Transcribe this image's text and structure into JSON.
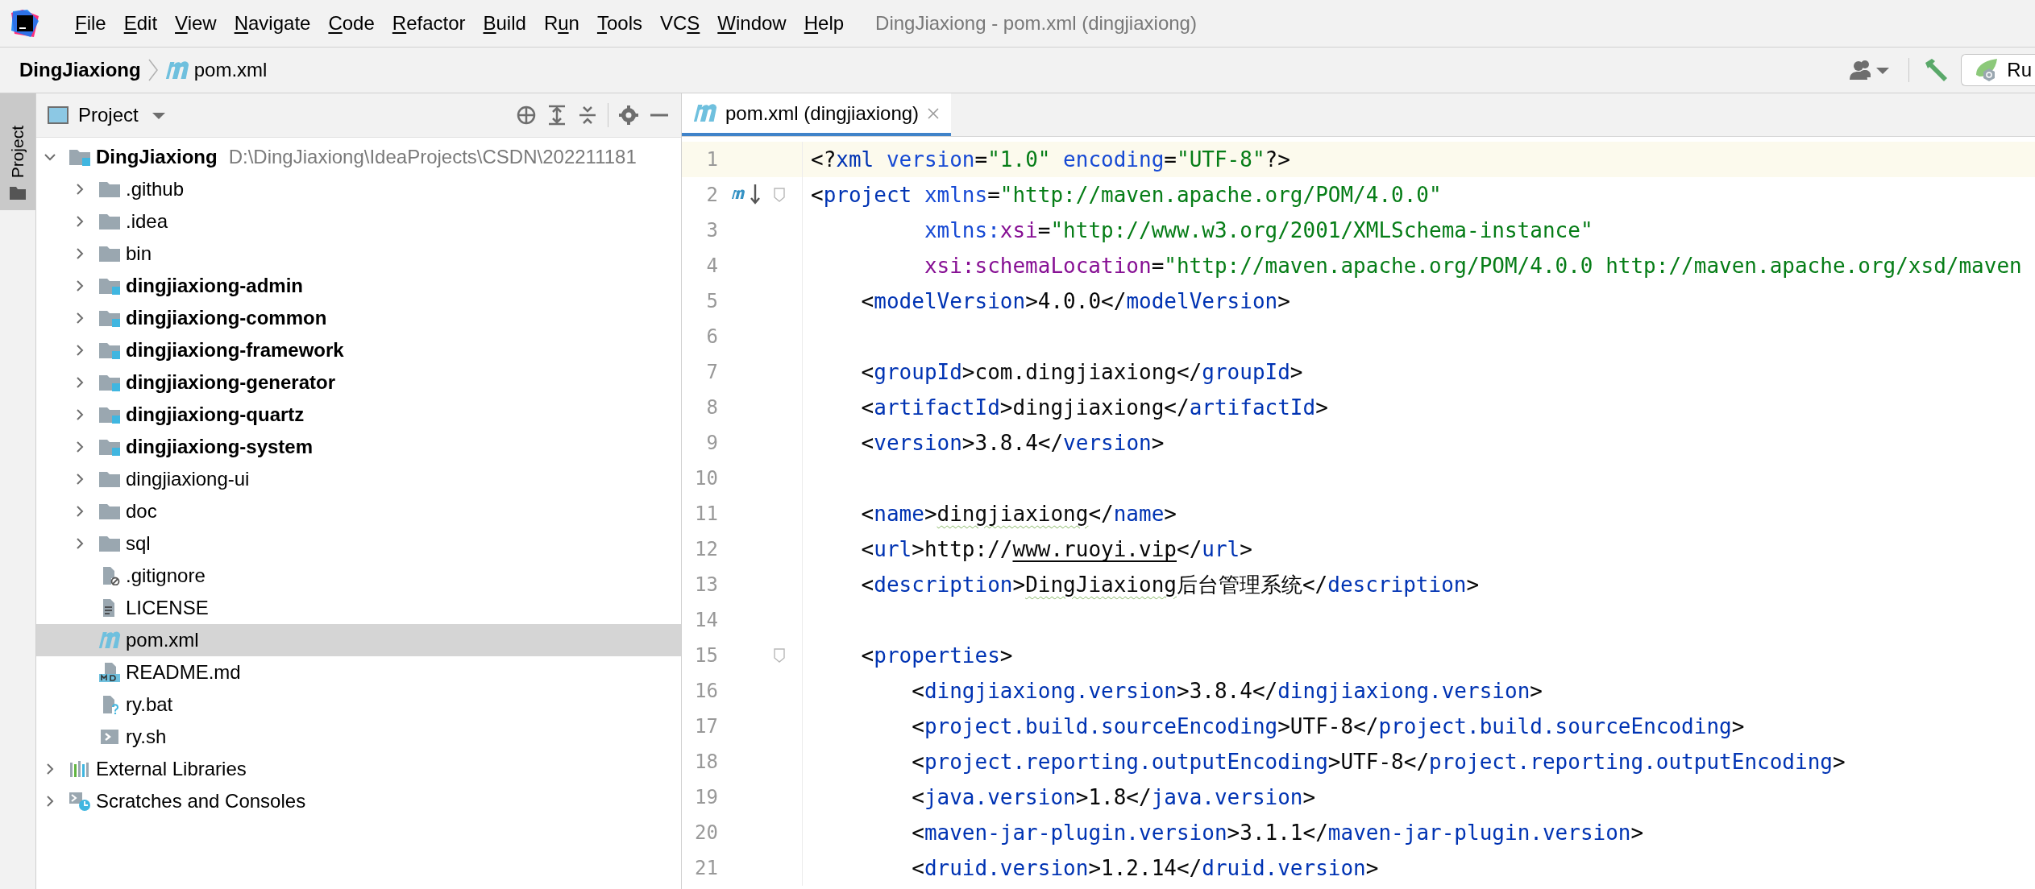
{
  "window": {
    "title": "DingJiaxiong - pom.xml (dingjiaxiong)"
  },
  "menu": [
    {
      "key": "F",
      "post": "ile"
    },
    {
      "key": "E",
      "post": "dit"
    },
    {
      "key": "V",
      "post": "iew"
    },
    {
      "key": "N",
      "post": "avigate"
    },
    {
      "key": "C",
      "post": "ode"
    },
    {
      "key": "R",
      "post": "efactor"
    },
    {
      "key": "B",
      "post": "uild"
    },
    {
      "pre": "R",
      "key": "u",
      "post": "n"
    },
    {
      "key": "T",
      "post": "ools"
    },
    {
      "pre": "VC",
      "key": "S"
    },
    {
      "key": "W",
      "post": "indow"
    },
    {
      "key": "H",
      "post": "elp"
    }
  ],
  "breadcrumbs": [
    {
      "label": "DingJiaxiong",
      "kind": "project"
    },
    {
      "label": "pom.xml",
      "kind": "maven"
    }
  ],
  "toolbar": {
    "run_config": "Ru"
  },
  "side_stripe": {
    "label": "Project"
  },
  "project_panel": {
    "title": "Project",
    "tree": [
      {
        "label": "DingJiaxiong",
        "path": "D:\\DingJiaxiong\\IdeaProjects\\CSDN\\202211181",
        "kind": "module",
        "expanded": true,
        "selected": false,
        "children": [
          {
            "label": ".github",
            "kind": "folder",
            "expanded": false,
            "selected": false
          },
          {
            "label": ".idea",
            "kind": "folder",
            "expanded": false,
            "selected": false
          },
          {
            "label": "bin",
            "kind": "folder",
            "expanded": false,
            "selected": false
          },
          {
            "label": "dingjiaxiong-admin",
            "kind": "module",
            "expanded": false,
            "selected": false
          },
          {
            "label": "dingjiaxiong-common",
            "kind": "module",
            "expanded": false,
            "selected": false
          },
          {
            "label": "dingjiaxiong-framework",
            "kind": "module",
            "expanded": false,
            "selected": false
          },
          {
            "label": "dingjiaxiong-generator",
            "kind": "module",
            "expanded": false,
            "selected": false
          },
          {
            "label": "dingjiaxiong-quartz",
            "kind": "module",
            "expanded": false,
            "selected": false
          },
          {
            "label": "dingjiaxiong-system",
            "kind": "module",
            "expanded": false,
            "selected": false
          },
          {
            "label": "dingjiaxiong-ui",
            "kind": "folder",
            "expanded": false,
            "selected": false
          },
          {
            "label": "doc",
            "kind": "folder",
            "expanded": false,
            "selected": false
          },
          {
            "label": "sql",
            "kind": "folder",
            "expanded": false,
            "selected": false
          },
          {
            "label": ".gitignore",
            "kind": "ignore",
            "selected": false
          },
          {
            "label": "LICENSE",
            "kind": "text",
            "selected": false
          },
          {
            "label": "pom.xml",
            "kind": "maven",
            "selected": true
          },
          {
            "label": "README.md",
            "kind": "markdown",
            "selected": false
          },
          {
            "label": "ry.bat",
            "kind": "unknown",
            "selected": false
          },
          {
            "label": "ry.sh",
            "kind": "shell",
            "selected": false
          }
        ]
      },
      {
        "label": "External Libraries",
        "kind": "libraries",
        "expanded": false,
        "selected": false
      },
      {
        "label": "Scratches and Consoles",
        "kind": "scratches",
        "expanded": false,
        "selected": false
      }
    ]
  },
  "editor": {
    "tabs": [
      {
        "label": "pom.xml (dingjiaxiong)",
        "selected": true
      }
    ],
    "lines": [
      {
        "number": "1",
        "current": true,
        "fold": false,
        "tokens": [
          {
            "kind": "punct",
            "text": "<?"
          },
          {
            "kind": "tag",
            "text": "xml"
          },
          {
            "kind": "attr",
            "text": " version"
          },
          {
            "kind": "punct",
            "text": "="
          },
          {
            "kind": "value",
            "text": "\"1.0\""
          },
          {
            "kind": "attr",
            "text": " encoding"
          },
          {
            "kind": "punct",
            "text": "="
          },
          {
            "kind": "value",
            "text": "\"UTF-8\""
          },
          {
            "kind": "punct",
            "text": "?>"
          }
        ]
      },
      {
        "number": "2",
        "current": false,
        "fold": true,
        "gutter": {
          "kind": "maven"
        },
        "tokens": [
          {
            "kind": "punct",
            "text": "<"
          },
          {
            "kind": "tag",
            "text": "project"
          },
          {
            "kind": "attr",
            "text": " xmlns"
          },
          {
            "kind": "punct",
            "text": "="
          },
          {
            "kind": "value",
            "text": "\"http://maven.apache.org/POM/4.0.0\""
          }
        ]
      },
      {
        "number": "3",
        "current": false,
        "fold": false,
        "tokens": [
          {
            "kind": "attr",
            "text": "         xmlns:"
          },
          {
            "kind": "ns",
            "text": "xsi"
          },
          {
            "kind": "punct",
            "text": "="
          },
          {
            "kind": "value",
            "text": "\"http://www.w3.org/2001/XMLSchema-instance\""
          }
        ]
      },
      {
        "number": "4",
        "current": false,
        "fold": false,
        "tokens": [
          {
            "kind": "ns",
            "text": "         xsi:schemaLocation"
          },
          {
            "kind": "punct",
            "text": "="
          },
          {
            "kind": "value",
            "text": "\"http://maven.apache.org/POM/4.0.0 http://maven.apache.org/xsd/maven"
          }
        ]
      },
      {
        "number": "5",
        "current": false,
        "fold": false,
        "tokens": [
          {
            "kind": "punct",
            "text": "    <"
          },
          {
            "kind": "tag",
            "text": "modelVersion"
          },
          {
            "kind": "punct",
            "text": ">"
          },
          {
            "kind": "text",
            "text": "4.0.0"
          },
          {
            "kind": "punct",
            "text": "</"
          },
          {
            "kind": "tag",
            "text": "modelVersion"
          },
          {
            "kind": "punct",
            "text": ">"
          }
        ]
      },
      {
        "number": "6",
        "current": false,
        "fold": false
      },
      {
        "number": "7",
        "current": false,
        "fold": false,
        "tokens": [
          {
            "kind": "punct",
            "text": "    <"
          },
          {
            "kind": "tag",
            "text": "groupId"
          },
          {
            "kind": "punct",
            "text": ">"
          },
          {
            "kind": "text",
            "text": "com.dingjiaxiong"
          },
          {
            "kind": "punct",
            "text": "</"
          },
          {
            "kind": "tag",
            "text": "groupId"
          },
          {
            "kind": "punct",
            "text": ">"
          }
        ]
      },
      {
        "number": "8",
        "current": false,
        "fold": false,
        "tokens": [
          {
            "kind": "punct",
            "text": "    <"
          },
          {
            "kind": "tag",
            "text": "artifactId"
          },
          {
            "kind": "punct",
            "text": ">"
          },
          {
            "kind": "text",
            "text": "dingjiaxiong"
          },
          {
            "kind": "punct",
            "text": "</"
          },
          {
            "kind": "tag",
            "text": "artifactId"
          },
          {
            "kind": "punct",
            "text": ">"
          }
        ]
      },
      {
        "number": "9",
        "current": false,
        "fold": false,
        "tokens": [
          {
            "kind": "punct",
            "text": "    <"
          },
          {
            "kind": "tag",
            "text": "version"
          },
          {
            "kind": "punct",
            "text": ">"
          },
          {
            "kind": "text",
            "text": "3.8.4"
          },
          {
            "kind": "punct",
            "text": "</"
          },
          {
            "kind": "tag",
            "text": "version"
          },
          {
            "kind": "punct",
            "text": ">"
          }
        ]
      },
      {
        "number": "10",
        "current": false,
        "fold": false
      },
      {
        "number": "11",
        "current": false,
        "fold": false,
        "tokens": [
          {
            "kind": "punct",
            "text": "    <"
          },
          {
            "kind": "tag",
            "text": "name"
          },
          {
            "kind": "punct",
            "text": ">"
          },
          {
            "kind": "typo",
            "text": "dingjiaxiong"
          },
          {
            "kind": "punct",
            "text": "</"
          },
          {
            "kind": "tag",
            "text": "name"
          },
          {
            "kind": "punct",
            "text": ">"
          }
        ]
      },
      {
        "number": "12",
        "current": false,
        "fold": false,
        "tokens": [
          {
            "kind": "punct",
            "text": "    <"
          },
          {
            "kind": "tag",
            "text": "url"
          },
          {
            "kind": "punct",
            "text": ">"
          },
          {
            "kind": "text",
            "text": "http://"
          },
          {
            "kind": "link",
            "text": "www.ruoyi.vip"
          },
          {
            "kind": "punct",
            "text": "</"
          },
          {
            "kind": "tag",
            "text": "url"
          },
          {
            "kind": "punct",
            "text": ">"
          }
        ]
      },
      {
        "number": "13",
        "current": false,
        "fold": false,
        "tokens": [
          {
            "kind": "punct",
            "text": "    <"
          },
          {
            "kind": "tag",
            "text": "description"
          },
          {
            "kind": "punct",
            "text": ">"
          },
          {
            "kind": "typo",
            "text": "DingJiaxiong"
          },
          {
            "kind": "text",
            "text": "后台管理系统"
          },
          {
            "kind": "punct",
            "text": "</"
          },
          {
            "kind": "tag",
            "text": "description"
          },
          {
            "kind": "punct",
            "text": ">"
          }
        ]
      },
      {
        "number": "14",
        "current": false,
        "fold": false
      },
      {
        "number": "15",
        "current": false,
        "fold": true,
        "tokens": [
          {
            "kind": "punct",
            "text": "    <"
          },
          {
            "kind": "tag",
            "text": "properties"
          },
          {
            "kind": "punct",
            "text": ">"
          }
        ]
      },
      {
        "number": "16",
        "current": false,
        "fold": false,
        "tokens": [
          {
            "kind": "punct",
            "text": "        <"
          },
          {
            "kind": "tag",
            "text": "dingjiaxiong.version"
          },
          {
            "kind": "punct",
            "text": ">"
          },
          {
            "kind": "text",
            "text": "3.8.4"
          },
          {
            "kind": "punct",
            "text": "</"
          },
          {
            "kind": "tag",
            "text": "dingjiaxiong.version"
          },
          {
            "kind": "punct",
            "text": ">"
          }
        ]
      },
      {
        "number": "17",
        "current": false,
        "fold": false,
        "tokens": [
          {
            "kind": "punct",
            "text": "        <"
          },
          {
            "kind": "tag",
            "text": "project.build.sourceEncoding"
          },
          {
            "kind": "punct",
            "text": ">"
          },
          {
            "kind": "text",
            "text": "UTF-8"
          },
          {
            "kind": "punct",
            "text": "</"
          },
          {
            "kind": "tag",
            "text": "project.build.sourceEncoding"
          },
          {
            "kind": "punct",
            "text": ">"
          }
        ]
      },
      {
        "number": "18",
        "current": false,
        "fold": false,
        "tokens": [
          {
            "kind": "punct",
            "text": "        <"
          },
          {
            "kind": "tag",
            "text": "project.reporting.outputEncoding"
          },
          {
            "kind": "punct",
            "text": ">"
          },
          {
            "kind": "text",
            "text": "UTF-8"
          },
          {
            "kind": "punct",
            "text": "</"
          },
          {
            "kind": "tag",
            "text": "project.reporting.outputEncoding"
          },
          {
            "kind": "punct",
            "text": ">"
          }
        ]
      },
      {
        "number": "19",
        "current": false,
        "fold": false,
        "tokens": [
          {
            "kind": "punct",
            "text": "        <"
          },
          {
            "kind": "tag",
            "text": "java.version"
          },
          {
            "kind": "punct",
            "text": ">"
          },
          {
            "kind": "text",
            "text": "1.8"
          },
          {
            "kind": "punct",
            "text": "</"
          },
          {
            "kind": "tag",
            "text": "java.version"
          },
          {
            "kind": "punct",
            "text": ">"
          }
        ]
      },
      {
        "number": "20",
        "current": false,
        "fold": false,
        "tokens": [
          {
            "kind": "punct",
            "text": "        <"
          },
          {
            "kind": "tag",
            "text": "maven-jar-plugin.version"
          },
          {
            "kind": "punct",
            "text": ">"
          },
          {
            "kind": "text",
            "text": "3.1.1"
          },
          {
            "kind": "punct",
            "text": "</"
          },
          {
            "kind": "tag",
            "text": "maven-jar-plugin.version"
          },
          {
            "kind": "punct",
            "text": ">"
          }
        ]
      },
      {
        "number": "21",
        "current": false,
        "fold": false,
        "tokens": [
          {
            "kind": "punct",
            "text": "        <"
          },
          {
            "kind": "tag",
            "text": "druid.version"
          },
          {
            "kind": "punct",
            "text": ">"
          },
          {
            "kind": "text",
            "text": "1.2.14"
          },
          {
            "kind": "punct",
            "text": "</"
          },
          {
            "kind": "tag",
            "text": "druid.version"
          },
          {
            "kind": "punct",
            "text": ">"
          }
        ]
      }
    ]
  }
}
